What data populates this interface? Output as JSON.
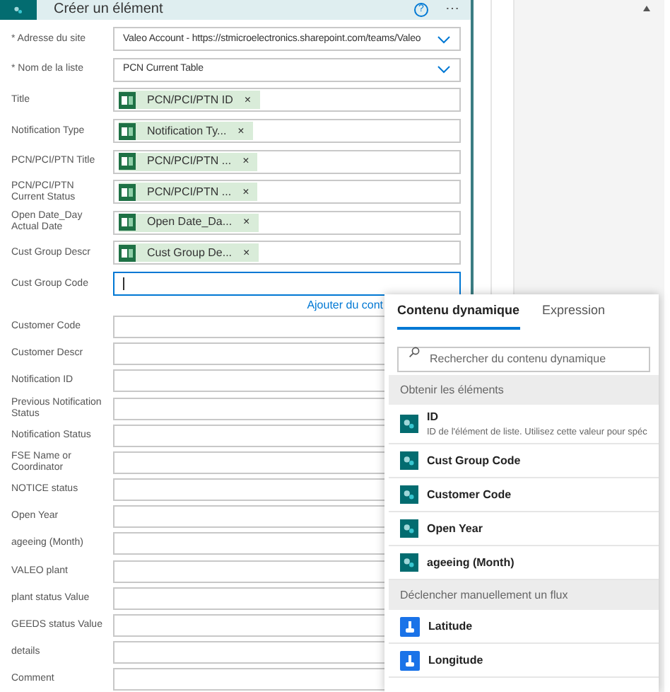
{
  "card": {
    "title": "Créer un élément",
    "help": "?",
    "more": "⋯"
  },
  "fields": [
    {
      "kind": "dropdown",
      "label": "* Adresse du site",
      "value": "Valeo Account - https://stmicroelectronics.sharepoint.com/teams/Valeo"
    },
    {
      "kind": "dropdown",
      "label": "* Nom de la liste",
      "value": "PCN Current Table"
    },
    {
      "kind": "token",
      "label": "Title",
      "token": "PCN/PCI/PTN ID",
      "remove": "×"
    },
    {
      "kind": "token",
      "label": "Notification Type",
      "token": "Notification Ty...",
      "remove": "×"
    },
    {
      "kind": "token",
      "label": "PCN/PCI/PTN Title",
      "token": "PCN/PCI/PTN ...",
      "remove": "×"
    },
    {
      "kind": "token",
      "label": "PCN/PCI/PTN Current Status",
      "token": "PCN/PCI/PTN ...",
      "remove": "×"
    },
    {
      "kind": "token",
      "label": "Open Date_Day Actual Date",
      "token": "Open Date_Da...",
      "remove": "×"
    },
    {
      "kind": "token",
      "label": "Cust Group Descr",
      "token": "Cust Group De...",
      "remove": "×"
    },
    {
      "kind": "text",
      "label": "Cust Group Code",
      "focused": true
    }
  ],
  "link": "Ajouter du cont",
  "more_fields": [
    {
      "label": "Customer Code"
    },
    {
      "label": "Customer Descr"
    },
    {
      "label": "Notification ID"
    },
    {
      "label": "Previous Notification Status"
    },
    {
      "label": "Notification Status"
    },
    {
      "label": "FSE Name or Coordinator"
    },
    {
      "label": "NOTICE status"
    },
    {
      "label": "Open Year"
    },
    {
      "label": "ageeing (Month)"
    },
    {
      "label": "VALEO plant"
    },
    {
      "label": "plant status Value"
    },
    {
      "label": "GEEDS status Value"
    },
    {
      "label": "details"
    },
    {
      "label": "Comment"
    }
  ],
  "popup": {
    "tabs": [
      {
        "label": "Contenu dynamique",
        "selected": true
      },
      {
        "label": "Expression",
        "selected": false
      }
    ],
    "search": {
      "placeholder": "Rechercher du contenu dynamique"
    },
    "items": [
      {
        "kind": "section",
        "label": "Obtenir les éléments"
      },
      {
        "kind": "sharepoint",
        "label": "ID",
        "description": "ID de l'élément de liste. Utilisez cette valeur pour spéc"
      },
      {
        "kind": "sharepoint",
        "label": "Cust Group Code"
      },
      {
        "kind": "sharepoint",
        "label": "Customer Code"
      },
      {
        "kind": "sharepoint",
        "label": "Open Year"
      },
      {
        "kind": "sharepoint",
        "label": "ageeing (Month)"
      },
      {
        "kind": "section",
        "label": "Déclencher manuellement un flux"
      },
      {
        "kind": "trigger",
        "label": "Latitude"
      },
      {
        "kind": "trigger",
        "label": "Longitude"
      }
    ]
  }
}
